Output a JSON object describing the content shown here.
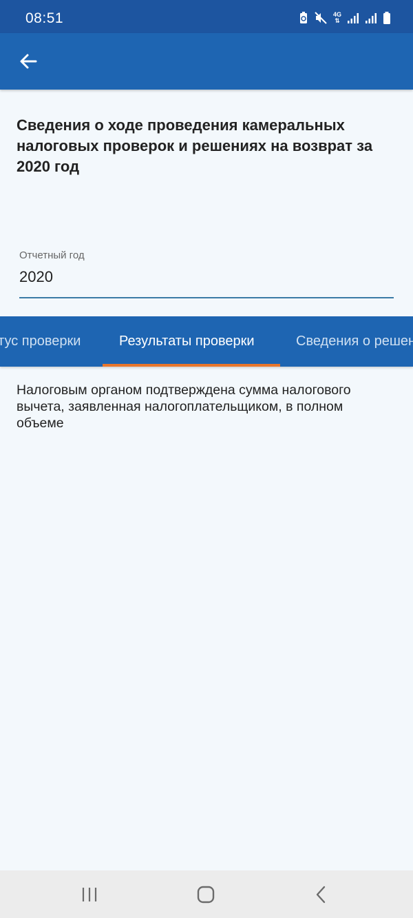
{
  "status_bar": {
    "time": "08:51",
    "network_label": "4G"
  },
  "page": {
    "title": "Сведения о ходе проведения камеральных налоговых проверок и решениях на возврат за 2020 год"
  },
  "year_field": {
    "label": "Отчетный год",
    "value": "2020"
  },
  "tabs": [
    {
      "label": "Статус проверки",
      "active": false
    },
    {
      "label": "Результаты проверки",
      "active": true
    },
    {
      "label": "Сведения о решениях",
      "active": false
    }
  ],
  "result": {
    "text": "Налоговым органом подтверждена сумма налогового вычета, заявленная налогоплательщиком, в полном объеме"
  },
  "colors": {
    "status_bar": "#1d55a0",
    "app_bar": "#1e65b2",
    "tab_indicator": "#e8762c",
    "background": "#f3f8fc"
  }
}
